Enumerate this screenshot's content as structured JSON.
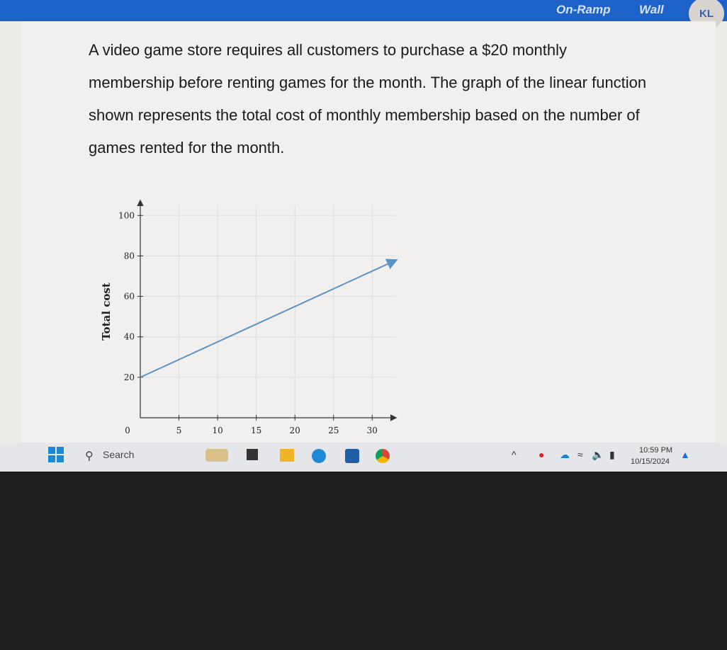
{
  "topbar": {
    "nav_items": [
      "On-Ramp",
      "Wall"
    ],
    "avatar": "KL",
    "color": "#1c62c9"
  },
  "question": {
    "text": "A video game store requires all customers to purchase a $20 monthly membership before renting games for the month. The graph of the linear function shown represents the total cost of monthly membership based on the number of games rented for the month."
  },
  "chart_data": {
    "type": "line",
    "title": "",
    "xlabel": "",
    "ylabel": "Total cost",
    "xlim": [
      0,
      33
    ],
    "ylim": [
      0,
      105
    ],
    "x_ticks": [
      0,
      5,
      10,
      15,
      20,
      25,
      30
    ],
    "y_ticks": [
      20,
      40,
      60,
      80,
      100
    ],
    "grid": true,
    "series": [
      {
        "x": [
          0,
          33
        ],
        "y": [
          20,
          77.75
        ],
        "color": "#5b93c7",
        "arrow_end": true
      }
    ]
  },
  "taskbar": {
    "search_label": "Search",
    "time": "10:59 PM",
    "date": "10/15/2024"
  }
}
